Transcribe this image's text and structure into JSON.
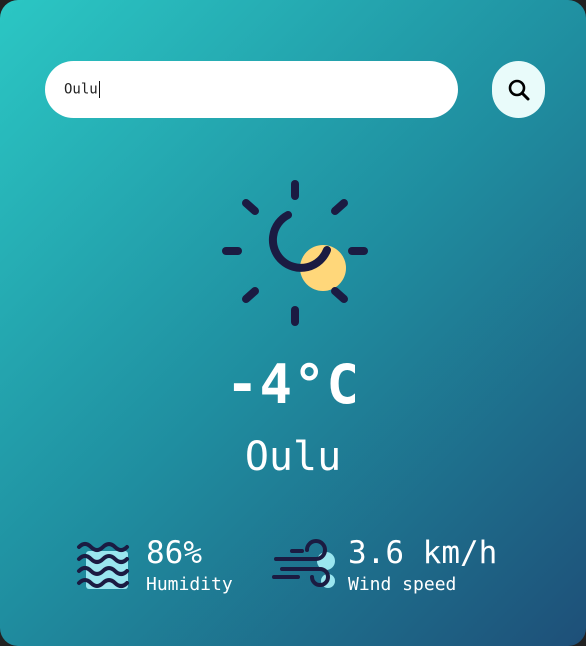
{
  "search": {
    "value": "Oulu",
    "icon": "search-icon"
  },
  "weather": {
    "icon": "sun-icon",
    "temperature": "-4°C",
    "city": "Oulu"
  },
  "humidity": {
    "icon": "humidity-icon",
    "value": "86%",
    "label": "Humidity"
  },
  "wind": {
    "icon": "wind-icon",
    "value": "3.6 km/h",
    "label": "Wind speed"
  },
  "colors": {
    "gradient_start": "#2bc7c4",
    "gradient_end": "#1e4f78",
    "sun_fill": "#ffd77a",
    "icon_stroke": "#1b1b42",
    "accent_light": "#9ae6ef"
  }
}
